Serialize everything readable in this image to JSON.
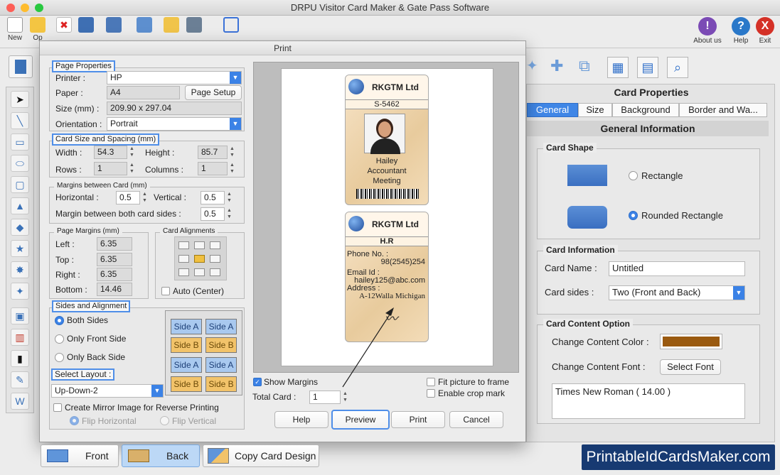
{
  "app": {
    "title": "DRPU Visitor Card Maker & Gate Pass Software"
  },
  "toolbar": {
    "new_label": "New",
    "open_label": "Op",
    "about_label": "About us",
    "help_label": "Help",
    "exit_label": "Exit",
    "about_glyph": "!",
    "help_glyph": "?",
    "exit_glyph": "X"
  },
  "print_dialog": {
    "title": "Print",
    "page_properties": {
      "legend": "Page Properties",
      "printer_label": "Printer :",
      "printer_value": "HP",
      "paper_label": "Paper :",
      "paper_value": "A4",
      "page_setup_button": "Page Setup",
      "size_label": "Size (mm) :",
      "size_value": "209.90 x 297.04",
      "orientation_label": "Orientation :",
      "orientation_value": "Portrait"
    },
    "card_size": {
      "legend": "Card Size and Spacing (mm)",
      "width_label": "Width :",
      "width_value": "54.3",
      "height_label": "Height :",
      "height_value": "85.7",
      "rows_label": "Rows :",
      "rows_value": "1",
      "columns_label": "Columns :",
      "columns_value": "1"
    },
    "margins_between": {
      "legend": "Margins between Card (mm)",
      "horizontal_label": "Horizontal :",
      "horizontal_value": "0.5",
      "vertical_label": "Vertical :",
      "vertical_value": "0.5",
      "both_sides_label": "Margin between both card sides :",
      "both_sides_value": "0.5"
    },
    "page_margins": {
      "legend": "Page Margins (mm)",
      "left_label": "Left :",
      "left_value": "6.35",
      "top_label": "Top :",
      "top_value": "6.35",
      "right_label": "Right :",
      "right_value": "6.35",
      "bottom_label": "Bottom :",
      "bottom_value": "14.46"
    },
    "card_alignments": {
      "legend": "Card Alignments",
      "auto_center_label": "Auto (Center)"
    },
    "sides": {
      "legend": "Sides and Alignment",
      "both_sides": "Both Sides",
      "only_front": "Only Front Side",
      "only_back": "Only Back Side",
      "select_layout_label": "Select Layout :",
      "layout_value": "Up-Down-2",
      "mirror_label": "Create Mirror Image for Reverse Printing",
      "flip_horizontal": "Flip Horizontal",
      "flip_vertical": "Flip Vertical",
      "layout_grid": [
        [
          "Side A",
          "Side A"
        ],
        [
          "Side B",
          "Side B"
        ],
        [
          "Side A",
          "Side A"
        ],
        [
          "Side B",
          "Side B"
        ]
      ]
    },
    "preview": {
      "front_card": {
        "company": "RKGTM Ltd",
        "id": "S-5462",
        "name": "Hailey",
        "role": "Accountant",
        "purpose": "Meeting"
      },
      "back_card": {
        "company": "RKGTM Ltd",
        "dept": "H.R",
        "phone_label": "Phone No. :",
        "phone_value": "98(2545)254",
        "email_label": "Email Id :",
        "email_value": "hailey125@abc.com",
        "address_label": "Address :",
        "address_value": "A-12Walla Michigan"
      }
    },
    "show_margins_label": "Show Margins",
    "total_card_label": "Total Card :",
    "total_card_value": "1",
    "fit_picture_label": "Fit picture to frame",
    "crop_mark_label": "Enable crop mark",
    "buttons": {
      "help": "Help",
      "preview": "Preview",
      "print": "Print",
      "cancel": "Cancel"
    }
  },
  "card_properties": {
    "title": "Card Properties",
    "tabs": [
      "General",
      "Size",
      "Background",
      "Border and Wa..."
    ],
    "section_title": "General Information",
    "card_shape": {
      "legend": "Card Shape",
      "rectangle": "Rectangle",
      "rounded_rectangle": "Rounded Rectangle"
    },
    "card_information": {
      "legend": "Card Information",
      "name_label": "Card Name :",
      "name_value": "Untitled",
      "sides_label": "Card sides :",
      "sides_value": "Two (Front and Back)"
    },
    "content_option": {
      "legend": "Card Content Option",
      "color_label": "Change Content Color :",
      "color_value": "#9a5a10",
      "font_label": "Change Content Font :",
      "select_font_button": "Select Font",
      "font_value": "Times New Roman ( 14.00 )"
    }
  },
  "bottom": {
    "front_label": "Front",
    "back_label": "Back",
    "copy_label": "Copy Card Design"
  },
  "brand": {
    "text": "PrintableIdCardsMaker.com"
  }
}
